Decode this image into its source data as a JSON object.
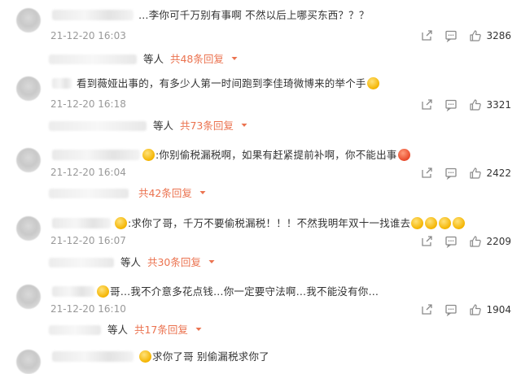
{
  "comments": [
    {
      "text": "…李你可千万别有事啊 不然以后上哪买东西？？？",
      "time": "21-12-20 16:03",
      "likes": "3286",
      "reply_who": "等人",
      "reply_total": "共48条回复"
    },
    {
      "text": "看到薇娅出事的，有多少人第一时间跑到李佳琦微博来的举个手",
      "time": "21-12-20 16:18",
      "likes": "3321",
      "reply_who": "等人",
      "reply_total": "共73条回复"
    },
    {
      "text": ":你别偷税漏税啊，如果有赶紧提前补啊，你不能出事",
      "time": "21-12-20 16:04",
      "likes": "2422",
      "reply_who": "",
      "reply_total": "共42条回复"
    },
    {
      "text": ":求你了哥，千万不要偷税漏税！！！不然我明年双十一找谁去",
      "time": "21-12-20 16:07",
      "likes": "2209",
      "reply_who": "等人",
      "reply_total": "共30条回复"
    },
    {
      "text": "哥…我不介意多花点钱…你一定要守法啊…我不能没有你…",
      "time": "21-12-20 16:10",
      "likes": "1904",
      "reply_who": "等人",
      "reply_total": "共17条回复"
    },
    {
      "text": "求你了哥 别偷漏税求你了"
    }
  ],
  "colors": {
    "accent": "#eb7350",
    "meta": "#999999",
    "text": "#333333",
    "icon": "#8a8a8a"
  }
}
